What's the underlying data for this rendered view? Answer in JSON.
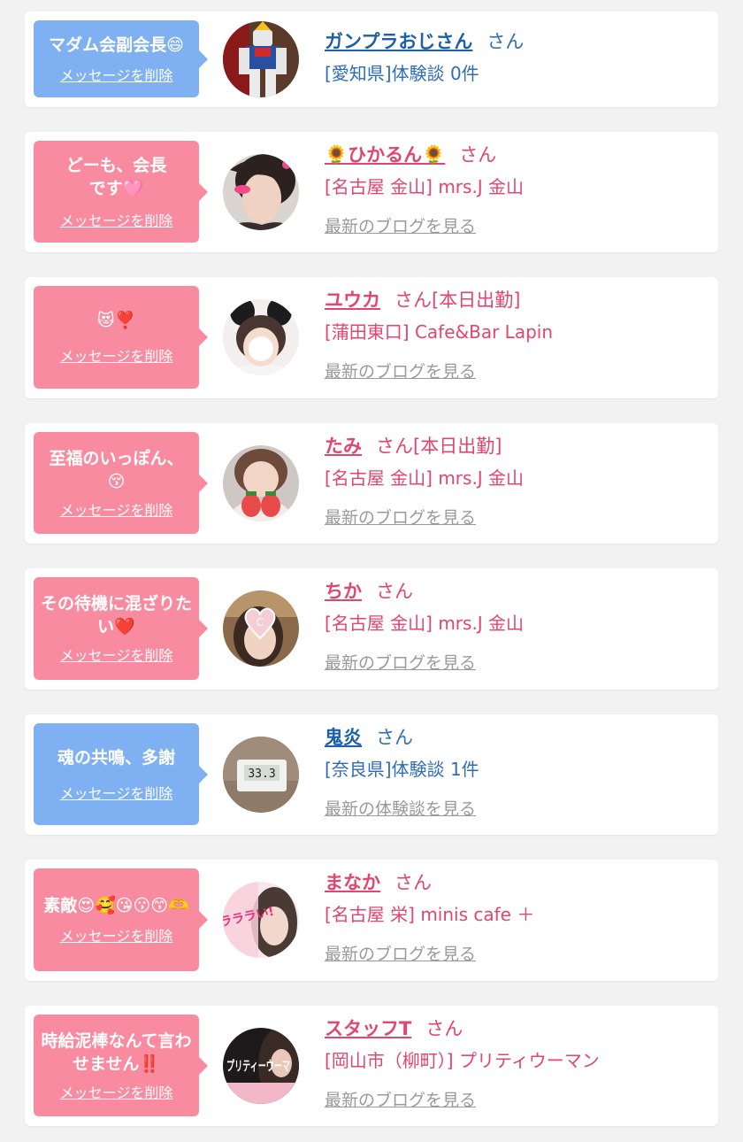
{
  "colors": {
    "pink_bubble": "#f98ba0",
    "blue_bubble": "#7fb0f2",
    "pink_text": "#e2456e",
    "blue_text": "#1d5fa8",
    "link_gray": "#9a9a9a"
  },
  "delete_label": "メッセージを削除",
  "san": "さん",
  "items": [
    {
      "bubble_color": "blue",
      "message": "マダム会副会長😄",
      "name": "ガンプラおじさん",
      "suffix": "",
      "sub": "[愛知県]体験談 0件",
      "link": "",
      "avatar_icon": "robot-figure-photo"
    },
    {
      "bubble_color": "pink",
      "message": "どーも、会長です🩷",
      "name": "🌻ひかるん🌻",
      "suffix": "",
      "sub": "[名古屋 金山] mrs.J 金山",
      "link": "最新のブログを見る",
      "avatar_icon": "woman-photo"
    },
    {
      "bubble_color": "pink",
      "message": "😻❣️",
      "name": "ユウカ",
      "suffix": "[本日出勤]",
      "sub": "[蒲田東口] Cafe&Bar Lapin",
      "link": "最新のブログを見る",
      "avatar_icon": "bunny-ears-photo"
    },
    {
      "bubble_color": "pink",
      "message": "至福のいっぽん、😚",
      "name": "たみ",
      "suffix": "[本日出勤]",
      "sub": "[名古屋 金山] mrs.J 金山",
      "link": "最新のブログを見る",
      "avatar_icon": "strawberry-photo"
    },
    {
      "bubble_color": "pink",
      "message": "その待機に混ざりたい❤️",
      "name": "ちか",
      "suffix": "",
      "sub": "[名古屋 金山] mrs.J 金山",
      "link": "最新のブログを見る",
      "avatar_icon": "heart-sticker-photo"
    },
    {
      "bubble_color": "blue",
      "message": "魂の共鳴、多謝",
      "name": "鬼炎",
      "suffix": "",
      "sub": "[奈良県]体験談 1件",
      "link": "最新の体験談を見る",
      "avatar_icon": "thermostat-photo",
      "avatar_text": "33.3"
    },
    {
      "bubble_color": "pink",
      "message": "素敵😍🥰😘😗😙🫶",
      "name": "まなか",
      "suffix": "",
      "sub": "[名古屋 栄] minis cafe ＋",
      "link": "最新のブログを見る",
      "avatar_icon": "magazine-photo",
      "avatar_text": "ラララい!"
    },
    {
      "bubble_color": "pink",
      "message": "時給泥棒なんて言わせません‼️",
      "name": "スタッフT",
      "suffix": "",
      "sub": "[岡山市（柳町）] プリティウーマン",
      "link": "最新のブログを見る",
      "avatar_icon": "pretty-woman-logo",
      "avatar_text": "プリティーウーマ"
    }
  ]
}
